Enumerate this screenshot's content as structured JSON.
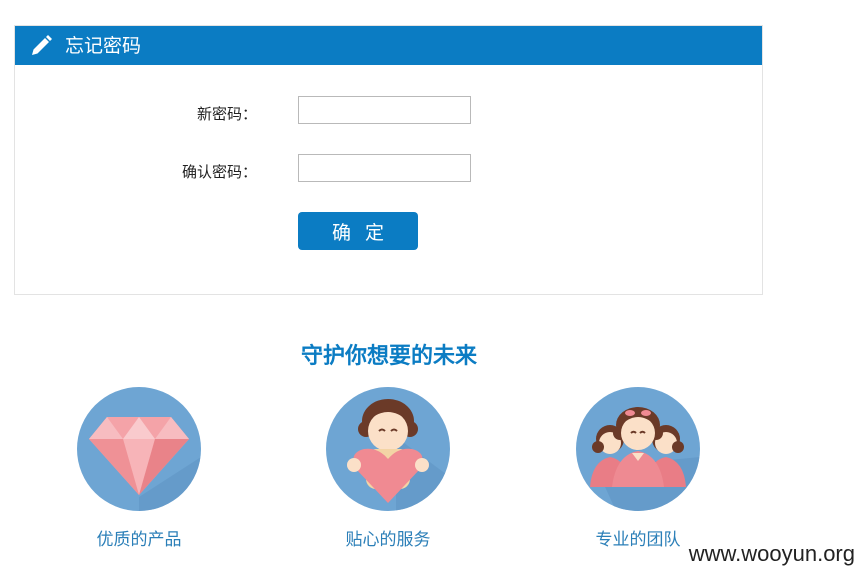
{
  "panel": {
    "title": "忘记密码",
    "new_password_label": "新密码：",
    "confirm_password_label": "确认密码：",
    "new_password_value": "",
    "confirm_password_value": "",
    "submit_label": "确定"
  },
  "slogan": "守护你想要的未来",
  "features": [
    {
      "label": "优质的产品",
      "icon": "diamond-icon"
    },
    {
      "label": "贴心的服务",
      "icon": "heart-person-icon"
    },
    {
      "label": "专业的团队",
      "icon": "team-icon"
    }
  ],
  "watermark": "www.wooyun.org",
  "colors": {
    "accent": "#0b7cc3",
    "circle": "#6ea5d3",
    "caption": "#2b7fb8"
  }
}
